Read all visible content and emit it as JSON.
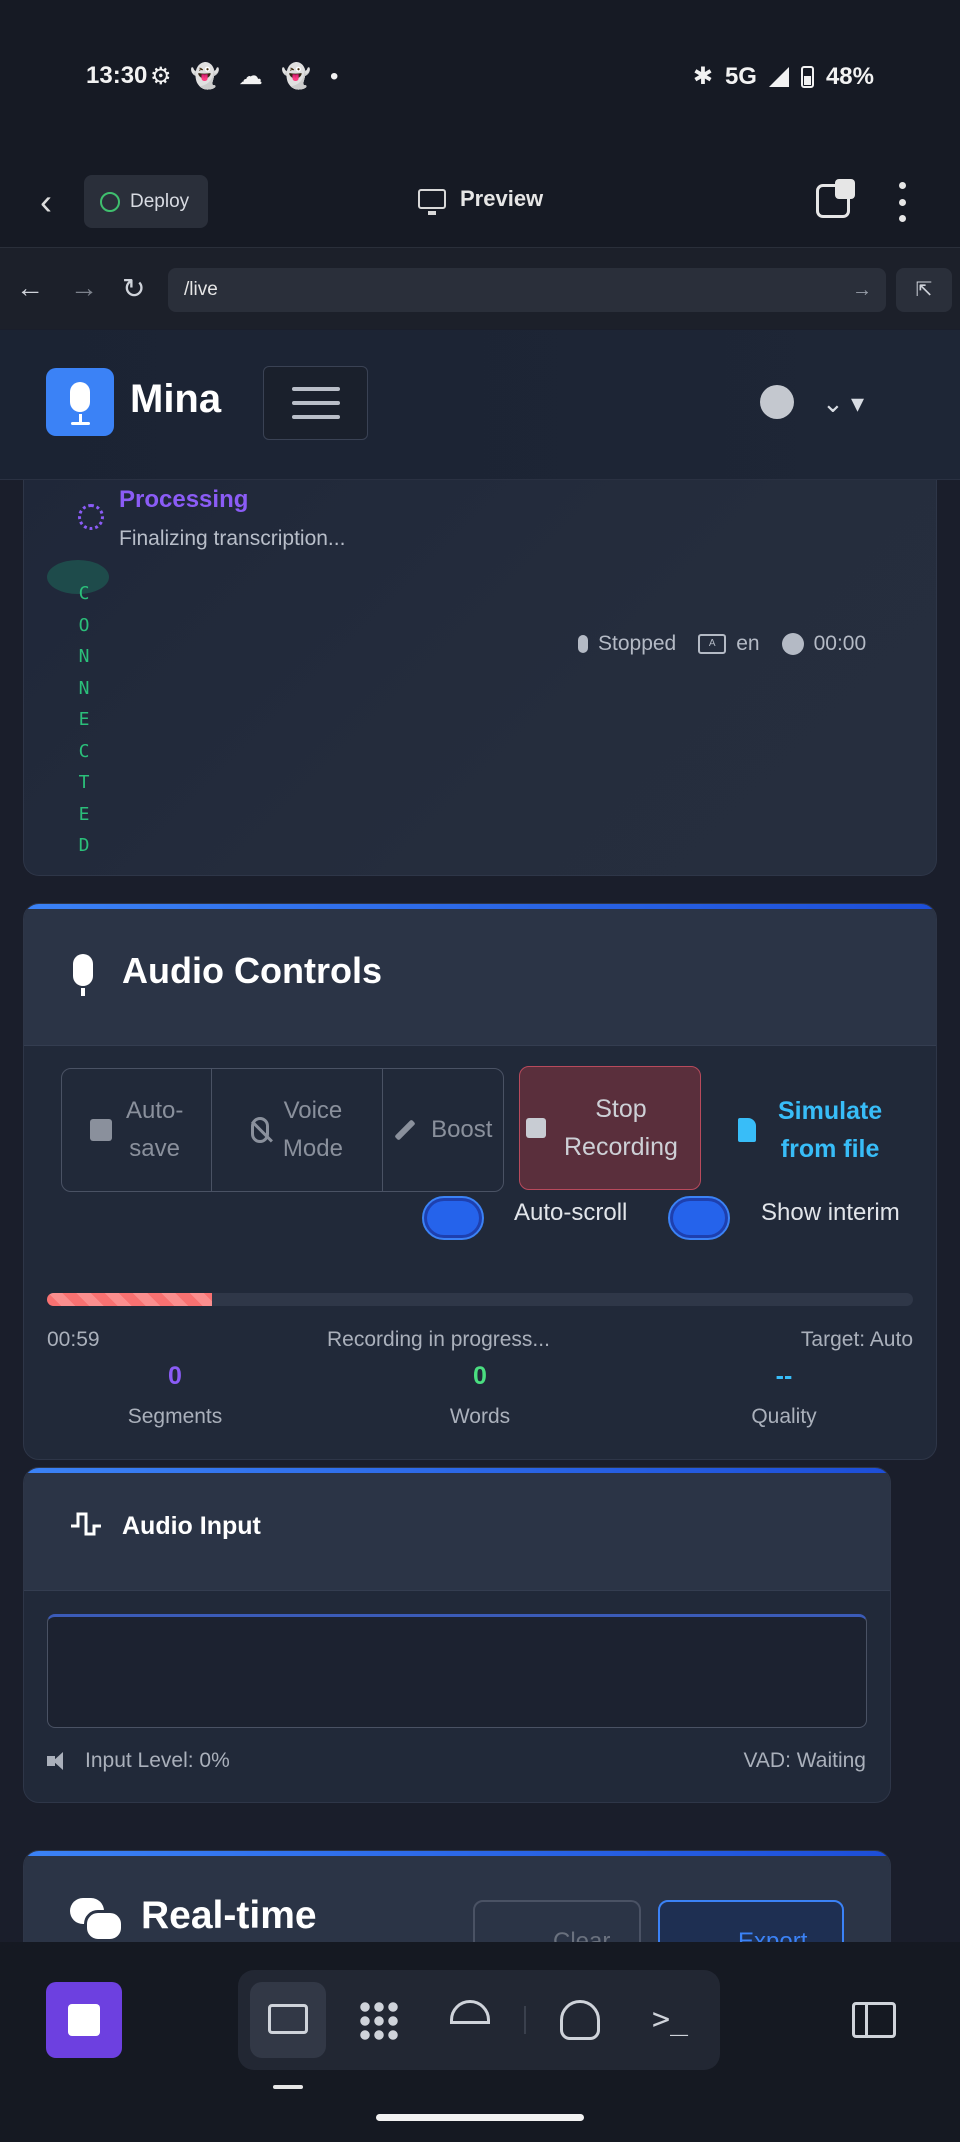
{
  "status_bar": {
    "time": "13:30",
    "notification_icons": "⚙ 👻 ☁ 👻 •",
    "network": "5G",
    "battery": "48%"
  },
  "preview_toolbar": {
    "deploy_label": "Deploy",
    "preview_label": "Preview"
  },
  "browser": {
    "url": "/live"
  },
  "app": {
    "brand": "Mina"
  },
  "status_card": {
    "state_title": "Processing",
    "state_detail": "Finalizing transcription...",
    "connection": "CONNECTED",
    "mic_state": "Stopped",
    "language": "en",
    "timer": "00:00"
  },
  "audio_controls": {
    "title": "Audio Controls",
    "autosave_label": "Auto-\nsave",
    "voice_mode_label": "Voice\nMode",
    "boost_label": "Boost",
    "stop_label": "Stop\nRecording",
    "simulate_label": "Simulate\nfrom file",
    "autoscroll_label": "Auto-scroll",
    "show_interim_label": "Show interim",
    "progress_fraction": 0.19,
    "elapsed": "00:59",
    "progress_status": "Recording in progress...",
    "target": "Target: Auto",
    "stats": [
      {
        "value": "0",
        "label": "Segments",
        "color": "#8b5cf6"
      },
      {
        "value": "0",
        "label": "Words",
        "color": "#4ade80"
      },
      {
        "value": "--",
        "label": "Quality",
        "color": "#38bdf8"
      }
    ]
  },
  "audio_input": {
    "title": "Audio Input",
    "input_level": "Input Level: 0%",
    "vad": "VAD: Waiting"
  },
  "realtime": {
    "title": "Real-time",
    "clear_label": "Clear",
    "export_label": "Export"
  }
}
